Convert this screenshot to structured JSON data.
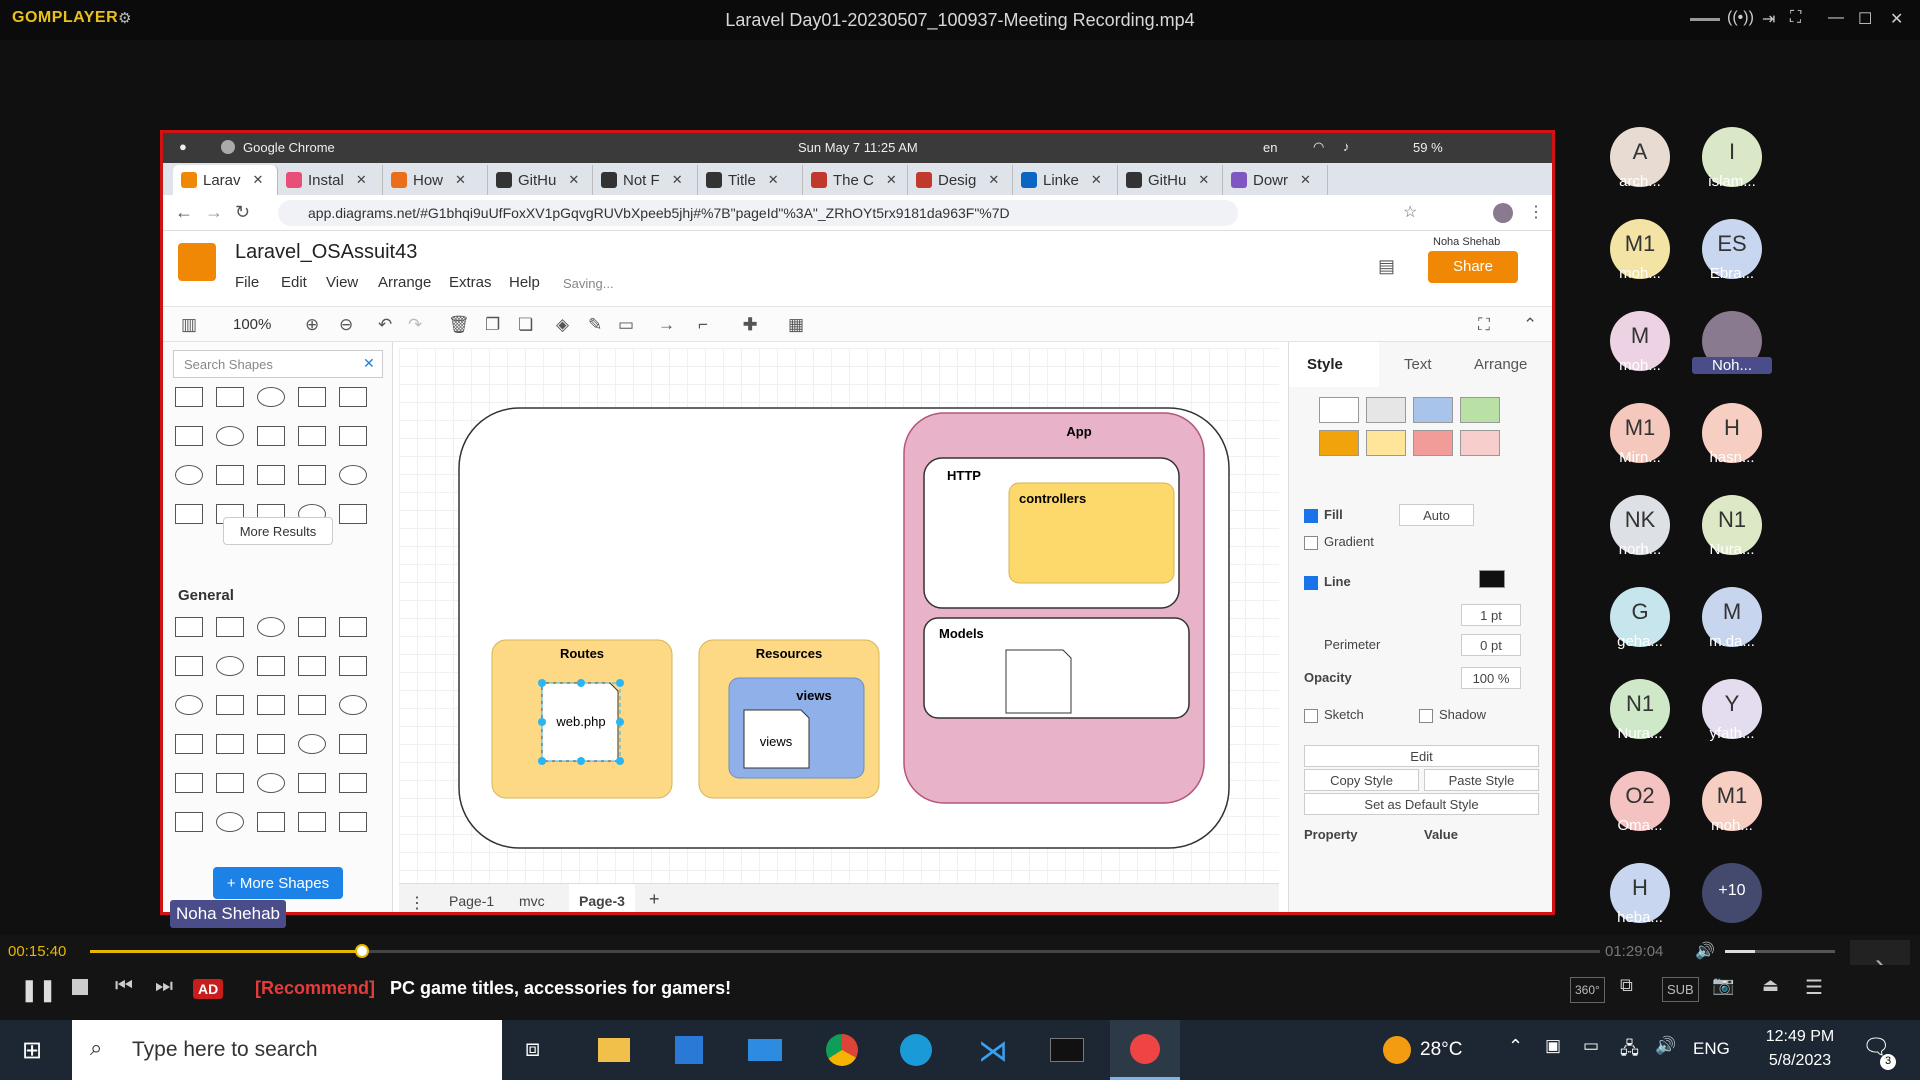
{
  "player": {
    "logo": "GOMPLAYER",
    "title": "Laravel Day01-20230507_100937-Meeting Recording.mp4",
    "time_current": "00:15:40",
    "time_total": "01:29:04",
    "progress": 0.18,
    "ad_badge": "AD",
    "ad_tag": "[Recommend]",
    "ad_text": "PC game titles, accessories for gamers!",
    "sub_label": "SUB",
    "badge_360": "360°"
  },
  "mac": {
    "app": "Google Chrome",
    "clock": "Sun May 7  11:25 AM",
    "lang": "en",
    "battery": "59 %"
  },
  "chrome": {
    "tabs": [
      "Larav",
      "Instal",
      "How",
      "GitHu",
      "Not F",
      "Title",
      "The C",
      "Desig",
      "Linke",
      "GitHu",
      "Dowr"
    ],
    "url": "app.diagrams.net/#G1bhqi9uUfFoxXV1pGqvgRUVbXpeeb5jhj#%7B\"pageId\"%3A\"_ZRhOYt5rx9181da963F\"%7D"
  },
  "drawio": {
    "title": "Laravel_OSAssuit43",
    "menu": [
      "File",
      "Edit",
      "View",
      "Arrange",
      "Extras",
      "Help"
    ],
    "saving": "Saving...",
    "user": "Noha Shehab",
    "share": "Share",
    "zoom": "100%",
    "search_placeholder": "Search Shapes",
    "more_results": "More Results",
    "general": "General",
    "more_shapes": "+ More Shapes",
    "pages": [
      "Page-1",
      "mvc",
      "Page-3"
    ],
    "diagram": {
      "app": "App",
      "http": "HTTP",
      "controllers": "controllers",
      "models": "Models",
      "routes": "Routes",
      "webphp": "web.php",
      "resources": "Resources",
      "views_group": "views",
      "views_doc": "views"
    },
    "style_panel": {
      "tabs": [
        "Style",
        "Text",
        "Arrange"
      ],
      "fill": "Fill",
      "fill_mode": "Auto",
      "gradient": "Gradient",
      "line": "Line",
      "line_width": "1 pt",
      "perimeter": "Perimeter",
      "perimeter_val": "0 pt",
      "opacity": "Opacity",
      "opacity_val": "100 %",
      "sketch": "Sketch",
      "shadow": "Shadow",
      "edit": "Edit",
      "copy_style": "Copy Style",
      "paste_style": "Paste Style",
      "default_style": "Set as Default Style",
      "property": "Property",
      "value": "Value"
    },
    "swatches": [
      "#ffffff",
      "#e6e6e6",
      "#a9c4eb",
      "#b9e0a5",
      "#f0a30a",
      "#ffe599",
      "#f19c99",
      "#f8cecc"
    ]
  },
  "presenter": "Noha Shehab",
  "participants": [
    {
      "initials": "A",
      "name": "arch...",
      "color": "#e8dcd2"
    },
    {
      "initials": "I",
      "name": "islam...",
      "color": "#dbe8c8"
    },
    {
      "initials": "M1",
      "name": "moh...",
      "color": "#f3e3a4"
    },
    {
      "initials": "ES",
      "name": "Ebra...",
      "color": "#c9d6ef"
    },
    {
      "initials": "M",
      "name": "moh...",
      "color": "#ecd2e2"
    },
    {
      "initials": "",
      "name": "Noh...",
      "color": "#8a7a8f"
    },
    {
      "initials": "M1",
      "name": "Mirn...",
      "color": "#f5c8bd"
    },
    {
      "initials": "H",
      "name": "hasn...",
      "color": "#f6cfc2"
    },
    {
      "initials": "NK",
      "name": "norh...",
      "color": "#dde0e4"
    },
    {
      "initials": "N1",
      "name": "Nura...",
      "color": "#dde9c6"
    },
    {
      "initials": "G",
      "name": "geha...",
      "color": "#c6e5ec"
    },
    {
      "initials": "M",
      "name": "m.da...",
      "color": "#c7d5ee"
    },
    {
      "initials": "N1",
      "name": "Nura...",
      "color": "#cfe8c8"
    },
    {
      "initials": "Y",
      "name": "yfath...",
      "color": "#e4dcef"
    },
    {
      "initials": "O2",
      "name": "Oma...",
      "color": "#f5c2c2"
    },
    {
      "initials": "M1",
      "name": "moh...",
      "color": "#f6cfc2"
    },
    {
      "initials": "H",
      "name": "heba...",
      "color": "#c9d6ef"
    },
    {
      "initials": "+10",
      "name": "",
      "color": "#444a6e"
    }
  ],
  "taskbar": {
    "search": "Type here to search",
    "weather": "28°C",
    "lang": "ENG",
    "time": "12:49 PM",
    "date": "5/8/2023",
    "notif": "3"
  }
}
